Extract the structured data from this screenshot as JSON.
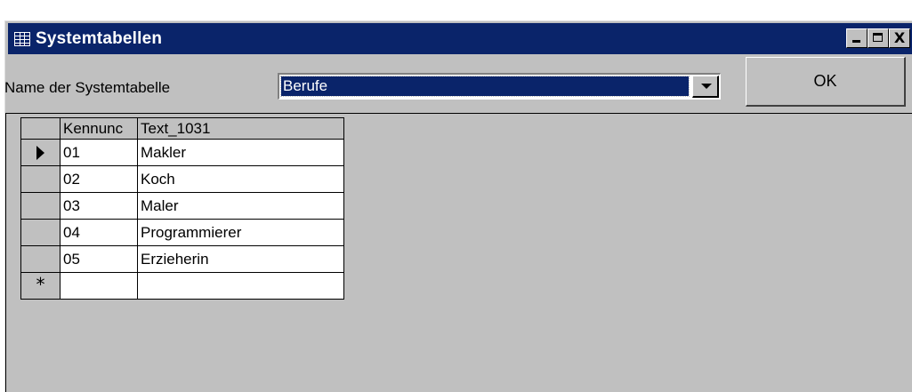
{
  "window": {
    "title": "Systemtabellen",
    "icon": "table-icon",
    "controls": [
      "minimize-icon",
      "maximize-icon",
      "close-icon"
    ],
    "close_glyph": "X"
  },
  "form": {
    "label": "Name der Systemtabelle",
    "combo_value": "Berufe",
    "ok_label": "OK"
  },
  "grid": {
    "columns": [
      "Kennung",
      "Text_1031"
    ],
    "header_display": [
      "Kennunc",
      "Text_1031"
    ],
    "rows": [
      {
        "kennung": "01",
        "text": "Makler"
      },
      {
        "kennung": "02",
        "text": "Koch"
      },
      {
        "kennung": "03",
        "text": "Maler"
      },
      {
        "kennung": "04",
        "text": "Programmierer"
      },
      {
        "kennung": "05",
        "text": "Erzieherin"
      }
    ],
    "current_row_indicator": "arrow-right-icon",
    "new_row_indicator": "*"
  },
  "colors": {
    "titlebar": "#0a246a",
    "face": "#c0c0c0",
    "selection": "#0a246a"
  }
}
